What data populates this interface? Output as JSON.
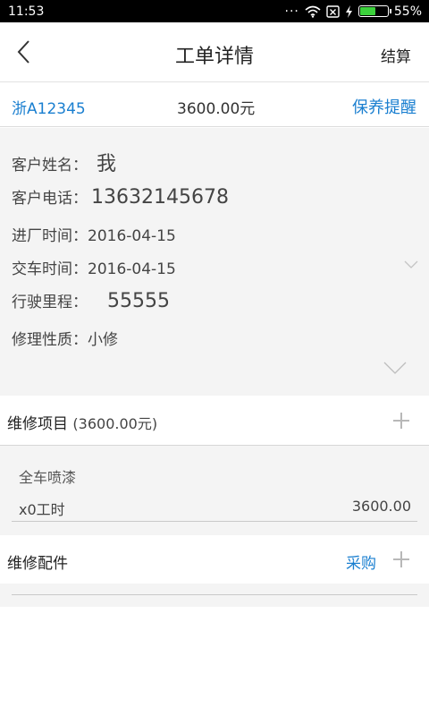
{
  "status_bar": {
    "time": "11:53",
    "dots": "···",
    "battery_percent": "55%",
    "battery_level": 0.55,
    "icons": [
      "wifi-icon",
      "no-sim-icon",
      "charging-icon",
      "battery-icon"
    ]
  },
  "header": {
    "title": "工单详情",
    "action_label": "结算"
  },
  "summary": {
    "plate": "浙A12345",
    "amount": "3600.00元",
    "reminder_label": "保养提醒"
  },
  "customer": {
    "name_label": "客户姓名：",
    "name_value": "我",
    "phone_label": "客户电话：",
    "phone_value": "13632145678",
    "entry_time": "进厂时间：2016-04-15",
    "delivery_time": "交车时间：2016-04-15",
    "mileage_label": "行驶里程：",
    "mileage_value": "55555",
    "repair_type": "修理性质：小修"
  },
  "repair_items": {
    "heading": "维修项目",
    "total": "(3600.00元)",
    "items": [
      {
        "name": "全车喷漆",
        "hours": "x0工时",
        "price": "3600.00"
      }
    ]
  },
  "parts": {
    "heading": "维修配件",
    "purchase_label": "采购"
  },
  "colors": {
    "accent": "#1a7fd0",
    "panel_bg": "#f4f4f4",
    "status_bar": "#000000"
  }
}
